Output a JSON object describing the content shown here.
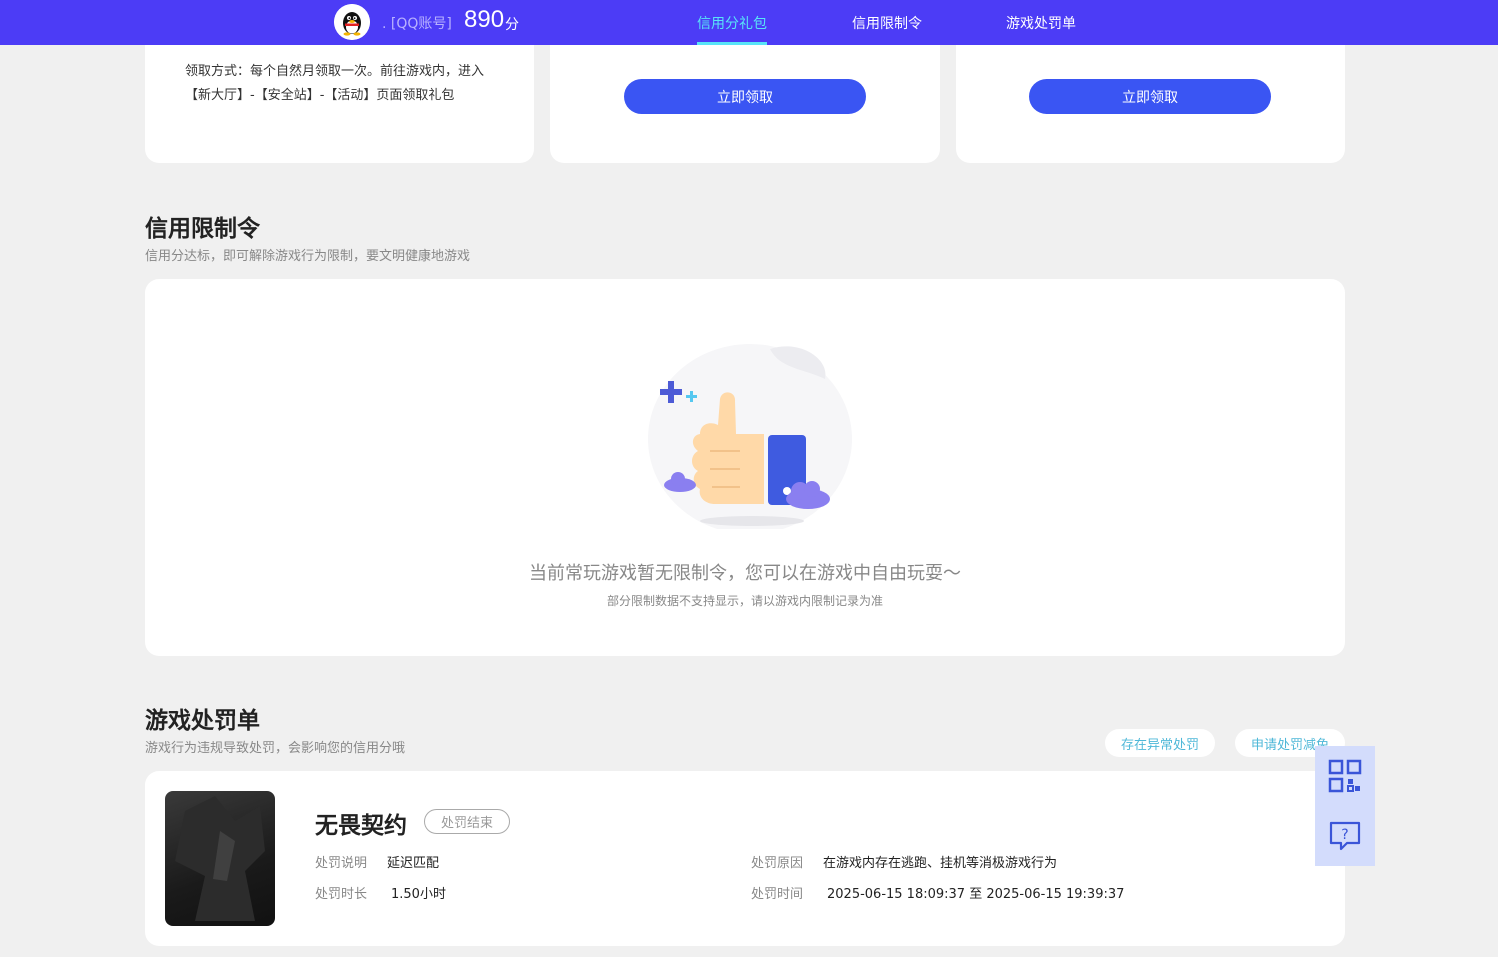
{
  "header": {
    "account_label": ". [QQ账号]",
    "score": "890",
    "score_unit": "分",
    "nav": [
      "信用分礼包",
      "信用限制令",
      "游戏处罚单"
    ]
  },
  "gift_cards": {
    "card1_text": "领取方式：每个自然月领取一次。前往游戏内，进入【新大厅】-【安全站】-【活动】页面领取礼包",
    "claim_label": "立即领取"
  },
  "restriction": {
    "title": "信用限制令",
    "subtitle": "信用分达标，即可解除游戏行为限制，要文明健康地游戏",
    "empty_main": "当前常玩游戏暂无限制令，您可以在游戏中自由玩耍～",
    "empty_sub": "部分限制数据不支持显示，请以游戏内限制记录为准"
  },
  "penalty": {
    "title": "游戏处罚单",
    "subtitle": "游戏行为违规导致处罚，会影响您的信用分哦",
    "btn_abnormal": "存在异常处罚",
    "btn_appeal": "申请处罚减免",
    "item": {
      "game": "无畏契约",
      "status": "处罚结束",
      "desc_label": "处罚说明",
      "desc_value": "延迟匹配",
      "duration_label": "处罚时长",
      "duration_value": "1.50小时",
      "reason_label": "处罚原因",
      "reason_value": "在游戏内存在逃跑、挂机等消极游戏行为",
      "time_label": "处罚时间",
      "time_value": "2025-06-15 18:09:37 至 2025-06-15 19:39:37"
    }
  },
  "icons": {
    "avatar": "qq-penguin-icon",
    "qrcode": "qrcode-icon",
    "help": "help-chat-icon"
  }
}
